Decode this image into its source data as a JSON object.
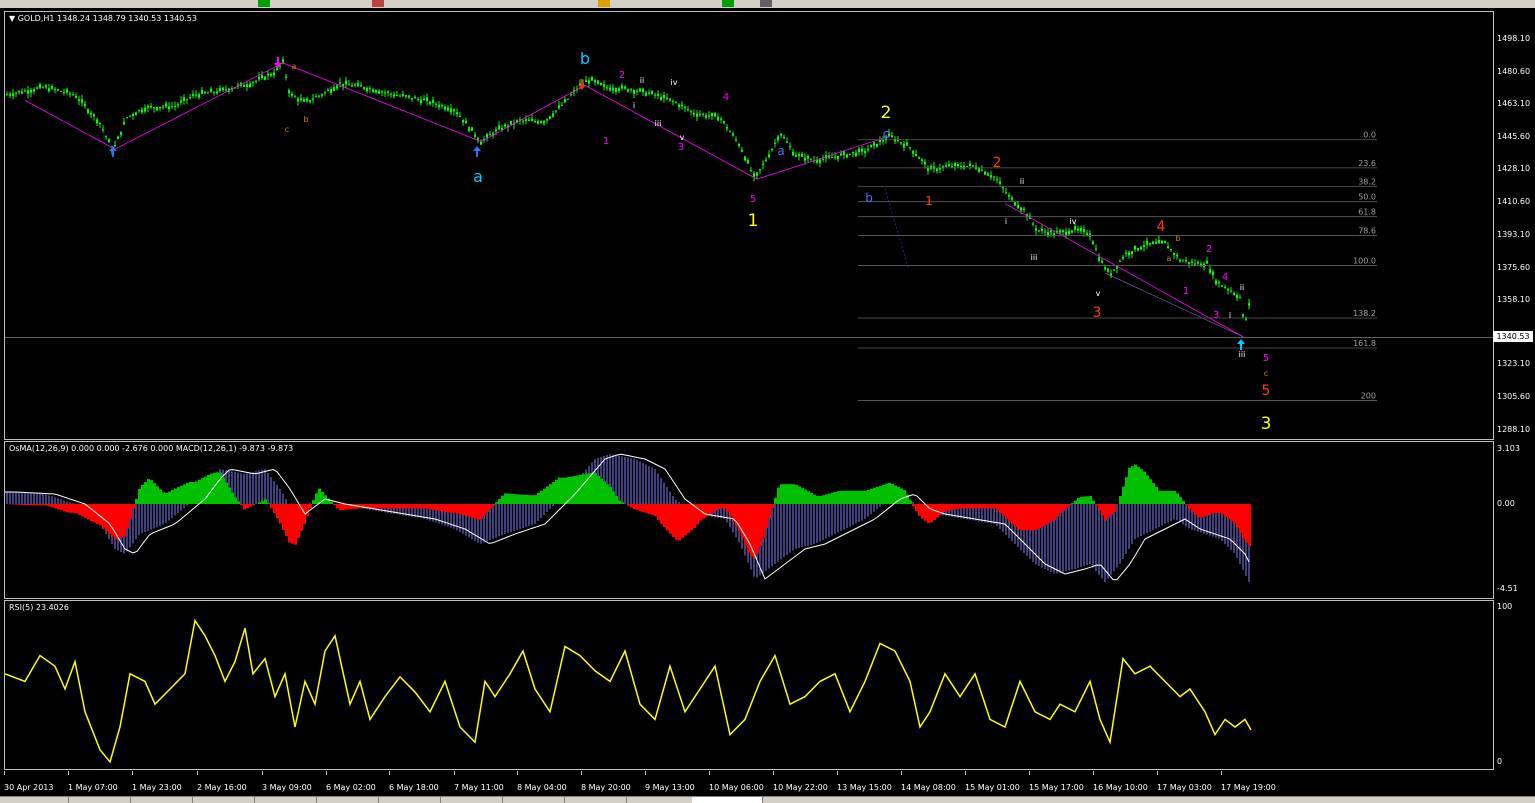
{
  "symbol_title": "GOLD,H1",
  "ohlc": "1348.24 1348.79 1340.53 1340.53",
  "current_price": "1340.53",
  "price_scale": [
    "1498.10",
    "1480.60",
    "1463.10",
    "1445.60",
    "1428.10",
    "1410.60",
    "1393.10",
    "1375.60",
    "1358.10",
    "1340.60",
    "1323.10",
    "1305.60",
    "1288.10"
  ],
  "fib_levels": [
    "0.0",
    "23.6",
    "38.2",
    "50.0",
    "61.8",
    "78.6",
    "100.0",
    "138.2",
    "161.8",
    "200"
  ],
  "wave_labels": {
    "major": [
      "a",
      "b",
      "a",
      "1",
      "2",
      "3"
    ],
    "minor": [
      "a",
      "b",
      "c",
      "a",
      "b",
      "c"
    ],
    "intermediate": [
      "1",
      "2",
      "3",
      "4",
      "5"
    ],
    "roman": [
      "i",
      "ii",
      "iii",
      "iv",
      "v"
    ],
    "orange": [
      "1",
      "2",
      "3",
      "4",
      "5"
    ]
  },
  "osma": {
    "title": "OsMA(12,26,9) 0.000 0.000 -2.676 0.000  MACD(12,26,1) -9.873 -9.873",
    "scale": [
      "3.103",
      "0.00",
      "-4.51"
    ]
  },
  "rsi": {
    "title": "RSI(5) 23.4026",
    "scale": [
      "100",
      "0"
    ]
  },
  "time_axis": [
    "30 Apr 2013",
    "1 May 07:00",
    "1 May 23:00",
    "2 May 16:00",
    "3 May 09:00",
    "6 May 02:00",
    "6 May 18:00",
    "7 May 11:00",
    "8 May 04:00",
    "8 May 20:00",
    "9 May 13:00",
    "10 May 06:00",
    "10 May 22:00",
    "13 May 15:00",
    "14 May 08:00",
    "15 May 01:00",
    "15 May 17:00",
    "16 May 10:00",
    "17 May 03:00",
    "17 May 19:00"
  ],
  "colors": {
    "candle": "#00ff00",
    "channel": "#ff00ff",
    "rsi_line": "#ffff00",
    "osma_pos": "#00c000",
    "osma_neg": "#ff0000",
    "macd": "#8080ff",
    "wave_cyan": "#00ccff",
    "wave_yellow": "#ffff00",
    "wave_blue": "#4060ff",
    "wave_magenta": "#ff00ff",
    "wave_orange": "#ff4000",
    "wave_white": "#ffffff"
  }
}
